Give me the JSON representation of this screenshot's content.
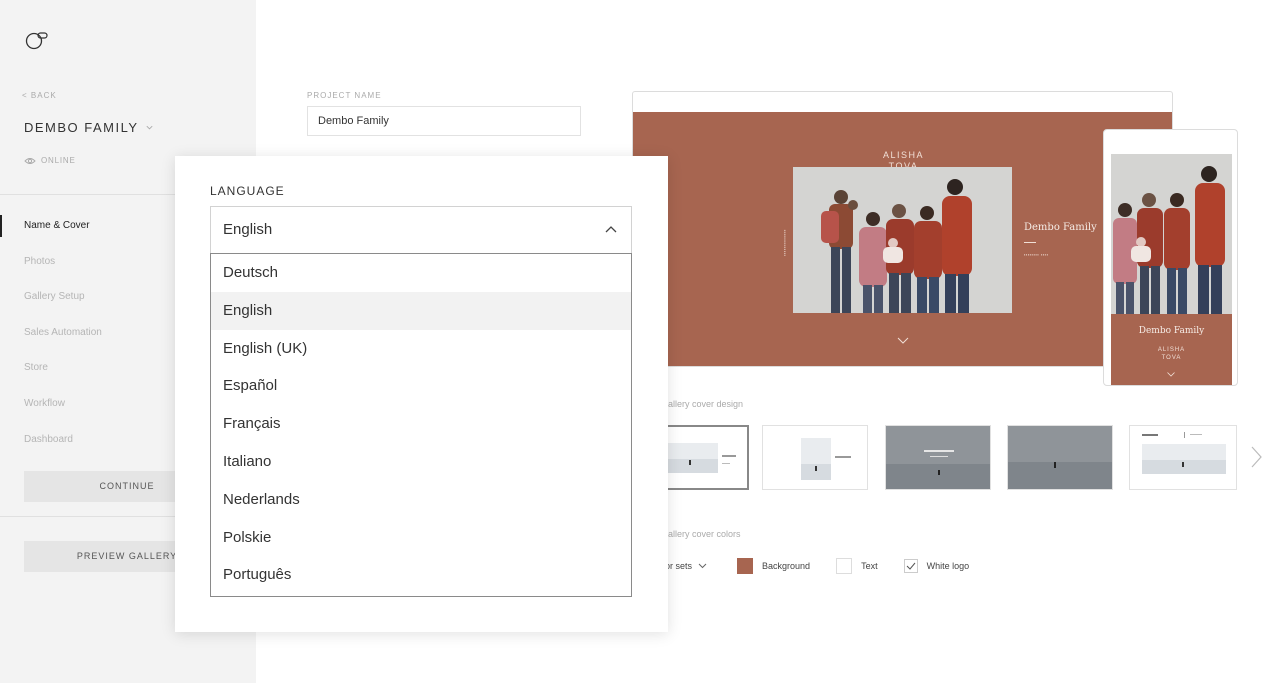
{
  "sidebar": {
    "back_label": "< BACK",
    "project_title": "DEMBO FAMILY",
    "status": "ONLINE",
    "nav": [
      {
        "label": "Name & Cover",
        "active": true
      },
      {
        "label": "Photos"
      },
      {
        "label": "Gallery Setup"
      },
      {
        "label": "Sales Automation"
      },
      {
        "label": "Store"
      },
      {
        "label": "Workflow"
      },
      {
        "label": "Dashboard"
      }
    ],
    "continue_label": "CONTINUE",
    "preview_label": "PREVIEW GALLERY"
  },
  "main": {
    "project_name_label": "PROJECT NAME",
    "project_name_value": "Dembo Family",
    "preview": {
      "names_line1": "ALISHA",
      "names_line2": "TOVA",
      "title": "Dembo Family",
      "accent": "#a76550"
    },
    "cover_design_label": "gallery cover design",
    "cover_colors_label": "gallery cover colors",
    "color_sets_label": "lor sets",
    "background_label": "Background",
    "text_label": "Text",
    "white_logo_label": "White logo"
  },
  "language": {
    "label": "LANGUAGE",
    "selected": "English",
    "options": [
      {
        "label": "Deutsch"
      },
      {
        "label": "English",
        "highlighted": true
      },
      {
        "label": "English (UK)"
      },
      {
        "label": "Español"
      },
      {
        "label": "Français"
      },
      {
        "label": "Italiano"
      },
      {
        "label": "Nederlands"
      },
      {
        "label": "Polskie"
      },
      {
        "label": "Português"
      }
    ]
  }
}
